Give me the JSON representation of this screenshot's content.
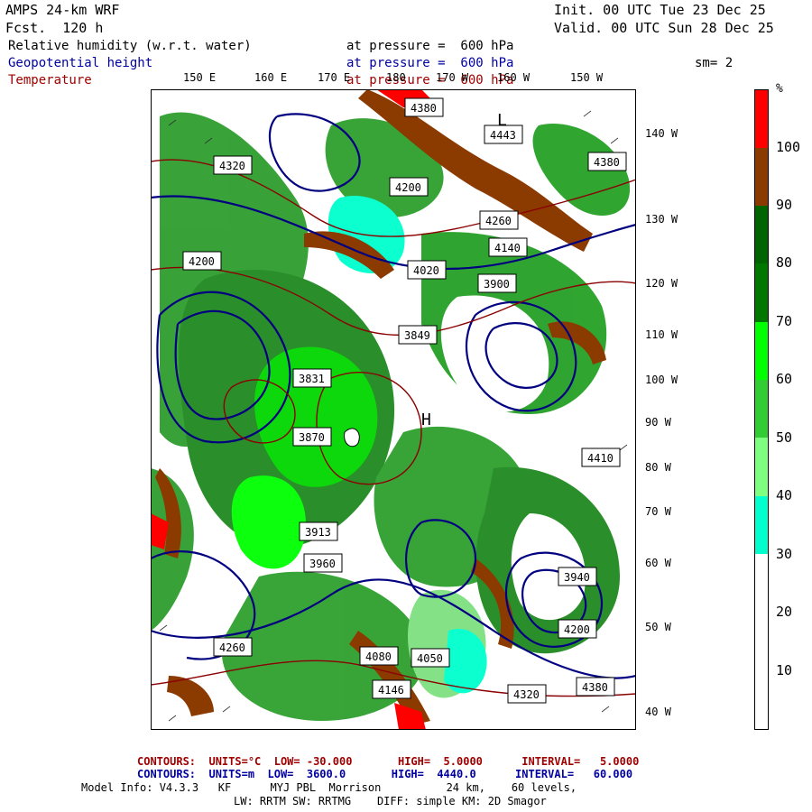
{
  "header": {
    "model": "AMPS 24-km WRF",
    "fcst": "Fcst.  120 h",
    "init": "Init. 00 UTC Tue 23 Dec 25",
    "valid": "Valid. 00 UTC Sun 28 Dec 25",
    "smoothing": "sm= 2"
  },
  "fields": [
    {
      "name": "Relative humidity (w.r.t. water)",
      "level": "at pressure =  600 hPa",
      "color": "#000000"
    },
    {
      "name": "Geopotential height",
      "level": "at pressure =  600 hPa",
      "color": "#0000a0"
    },
    {
      "name": "Temperature",
      "level": "at pressure =  600 hPa",
      "color": "#a00000"
    }
  ],
  "top_longitudes": [
    "150 E",
    "160 E",
    "170 E",
    "180",
    "170 W",
    "160 W",
    "150 W"
  ],
  "right_longitudes": [
    "140 W",
    "130 W",
    "120 W",
    "110 W",
    "100 W",
    "90 W",
    "80 W",
    "70 W",
    "60 W",
    "50 W",
    "40 W"
  ],
  "map_labels": [
    "4380",
    "4443",
    "4380",
    "4200",
    "4320",
    "4200",
    "4260",
    "4140",
    "4020",
    "3900",
    "3849",
    "3831",
    "3870",
    "3913",
    "3960",
    "4080",
    "4050",
    "4146",
    "4260",
    "4320",
    "4380",
    "4200",
    "4410",
    "3940",
    "L",
    "H"
  ],
  "colorbar": {
    "unit": "%",
    "labels": [
      "100",
      "90",
      "80",
      "70",
      "60",
      "50",
      "40",
      "30",
      "20",
      "10"
    ],
    "colors": [
      "#ff0000",
      "#8b3a00",
      "#006400",
      "#007800",
      "#00ff00",
      "#32cd32",
      "#7fff7f",
      "#00ffcc",
      "#ffffff",
      "#ffffff"
    ]
  },
  "footer": {
    "temp_contours": "CONTOURS:  UNITS=°C  LOW= -30.000       HIGH=  5.0000      INTERVAL=   5.0000",
    "height_contours": "CONTOURS:  UNITS=m  LOW=  3600.0       HIGH=  4440.0      INTERVAL=   60.000",
    "model_info_1": "Model Info: V4.3.3   KF      MYJ PBL  Morrison          24 km,    60 levels,",
    "model_info_2": "LW: RRTM SW: RRTMG    DIFF: simple KM: 2D Smagor"
  }
}
